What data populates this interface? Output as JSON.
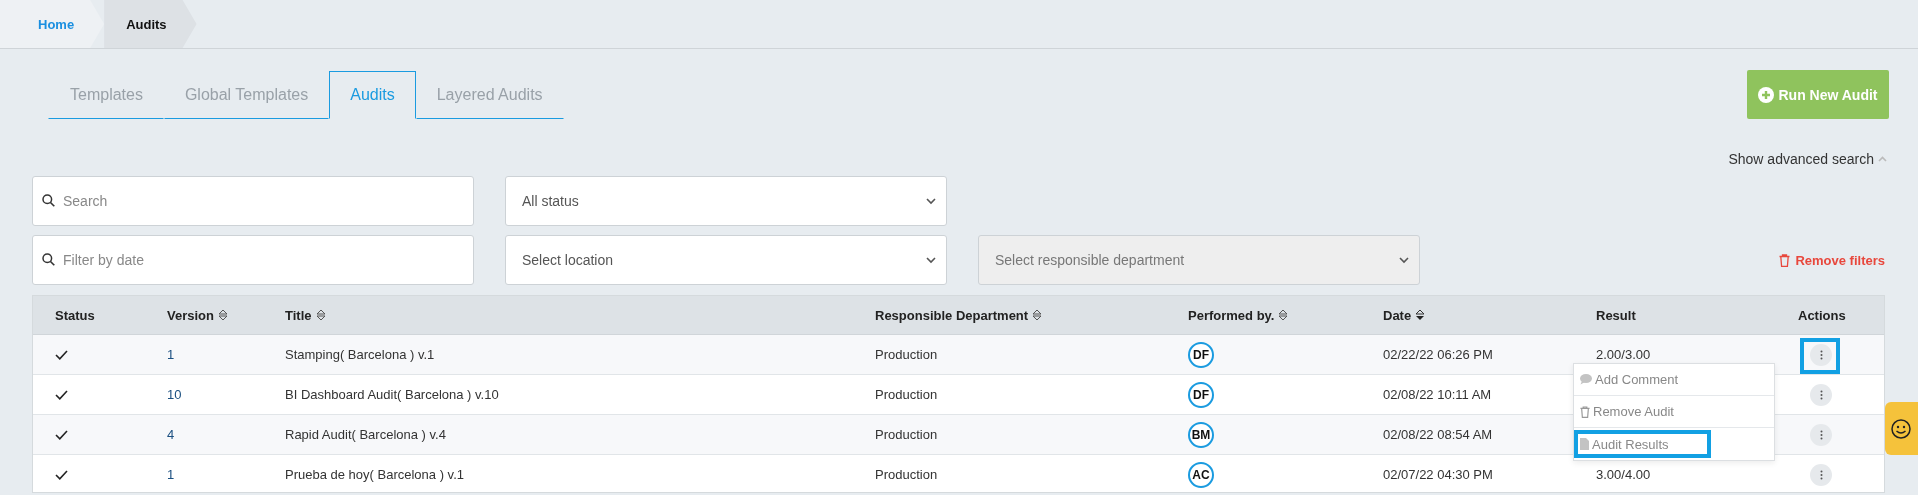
{
  "breadcrumb": [
    {
      "label": "Home",
      "selected": false
    },
    {
      "label": "Audits",
      "selected": true
    }
  ],
  "tabs": [
    {
      "label": "Templates",
      "selected": false
    },
    {
      "label": "Global Templates",
      "selected": false
    },
    {
      "label": "Audits",
      "selected": true
    },
    {
      "label": "Layered Audits",
      "selected": false
    }
  ],
  "run_button": {
    "label": "Run New Audit"
  },
  "advanced_search": {
    "label": "Show advanced search",
    "expanded": true
  },
  "filters": {
    "search": {
      "placeholder": "Search"
    },
    "date": {
      "placeholder": "Filter by date"
    },
    "status": {
      "value": "All status",
      "disabled": false
    },
    "location": {
      "value": "Select location",
      "disabled": false
    },
    "department": {
      "value": "Select responsible department",
      "disabled": true
    },
    "remove": "Remove filters"
  },
  "table": {
    "columns": [
      {
        "label": "Status",
        "sortable": false
      },
      {
        "label": "Version",
        "sortable": true
      },
      {
        "label": "Title",
        "sortable": true
      },
      {
        "label": "Responsible Department",
        "sortable": true
      },
      {
        "label": "Performed by.",
        "sortable": true
      },
      {
        "label": "Date",
        "sortable": true,
        "sorted": true
      },
      {
        "label": "Result",
        "sortable": false
      },
      {
        "label": "Actions",
        "sortable": false
      }
    ],
    "rows": [
      {
        "completed": true,
        "version": "1",
        "title": "Stamping( Barcelona ) v.1",
        "department": "Production",
        "performer": "DF",
        "date": "02/22/22 06:26 PM",
        "result": "2.00/3.00",
        "highlighted": true
      },
      {
        "completed": true,
        "version": "10",
        "title": "BI Dashboard Audit( Barcelona ) v.10",
        "department": "Production",
        "performer": "DF",
        "date": "02/08/22 10:11 AM",
        "highlighted": false
      },
      {
        "completed": true,
        "version": "4",
        "title": "Rapid Audit( Barcelona ) v.4",
        "department": "Production",
        "performer": "BM",
        "date": "02/08/22 08:54 AM",
        "highlighted": false
      },
      {
        "completed": true,
        "version": "1",
        "title": "Prueba de hoy( Barcelona ) v.1",
        "department": "Production",
        "performer": "AC",
        "date": "02/07/22 04:30 PM",
        "result": "3.00/4.00",
        "highlighted": false
      }
    ]
  },
  "action_menu": [
    {
      "kind": "comment",
      "label": "Add Comment",
      "highlighted": false
    },
    {
      "kind": "trash",
      "label": "Remove Audit",
      "highlighted": false
    },
    {
      "kind": "file",
      "label": "Audit Results",
      "highlighted": true
    }
  ]
}
